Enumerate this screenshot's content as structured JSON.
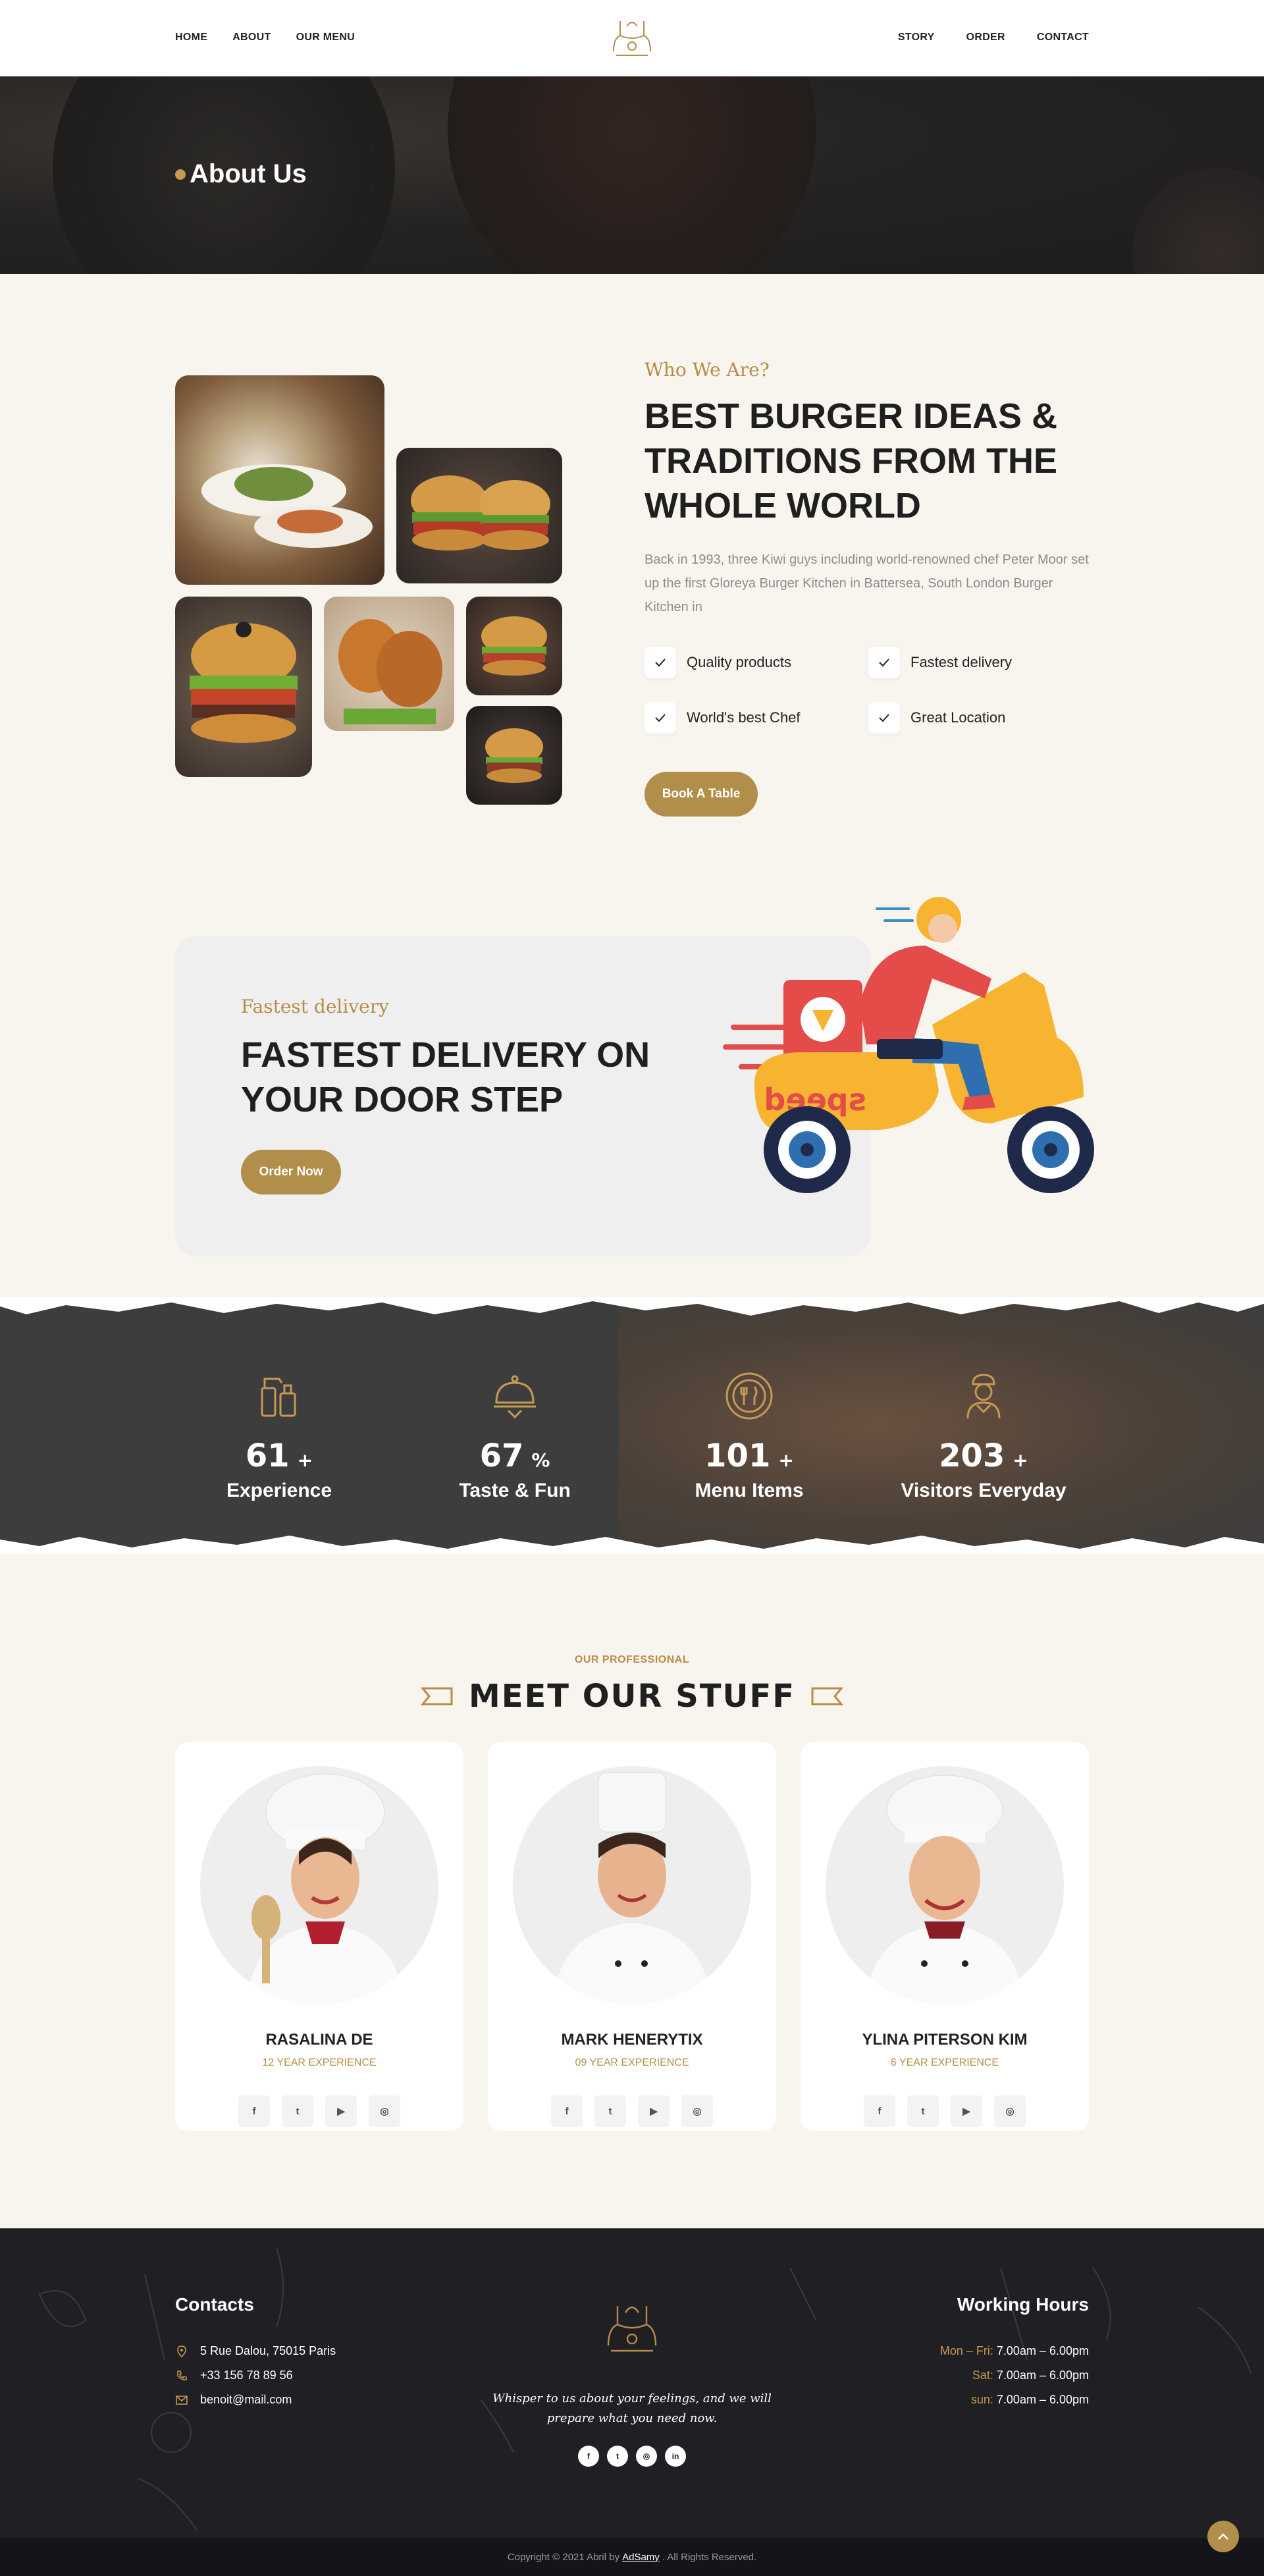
{
  "nav": {
    "left": [
      "HOME",
      "ABOUT",
      "OUR MENU"
    ],
    "right": [
      "STORY",
      "ORDER",
      "CONTACT"
    ]
  },
  "banner": {
    "title": "About Us"
  },
  "about": {
    "subtitle": "Who We Are?",
    "title": "BEST BURGER IDEAS & TRADITIONS FROM THE WHOLE WORLD",
    "text": "Back in 1993, three Kiwi guys including world-renowned chef Peter Moor set up the first Gloreya Burger Kitchen in Battersea, South London Burger Kitchen in",
    "features": [
      "Quality products",
      "Fastest delivery",
      "World's best Chef",
      "Great Location"
    ],
    "button": "Book A Table"
  },
  "delivery": {
    "subtitle": "Fastest delivery",
    "title": "FASTEST DELIVERY ON YOUR DOOR STEP",
    "button": "Order Now",
    "scooter_text": "speed"
  },
  "stats": [
    {
      "number": "61",
      "suffix": "+",
      "label": "Experience",
      "icon": "chef-tools-icon"
    },
    {
      "number": "67",
      "suffix": "%",
      "label": "Taste & Fun",
      "icon": "cloche-icon"
    },
    {
      "number": "101",
      "suffix": "+",
      "label": "Menu Items",
      "icon": "plate-cutlery-icon"
    },
    {
      "number": "203",
      "suffix": "+",
      "label": "Visitors Everyday",
      "icon": "chef-person-icon"
    }
  ],
  "team": {
    "subtitle": "OUR PROFESSIONAL",
    "title": "MEET OUR STUFF",
    "members": [
      {
        "name": "RASALINA DE",
        "experience": "12 YEAR EXPERIENCE"
      },
      {
        "name": "MARK HENERYTIX",
        "experience": "09 YEAR EXPERIENCE"
      },
      {
        "name": "YLINA PITERSON KIM",
        "experience": "6 YEAR EXPERIENCE"
      }
    ],
    "social_labels": [
      "f",
      "t",
      "▶",
      "◎"
    ]
  },
  "footer": {
    "contacts_title": "Contacts",
    "address": "5 Rue Dalou, 75015 Paris",
    "phone": "+33 156 78 89 56",
    "email": "benoit@mail.com",
    "quote": "Whisper to us about your feelings, and we will prepare what you need now.",
    "social_labels": [
      "f",
      "t",
      "◎",
      "in"
    ],
    "hours_title": "Working Hours",
    "hours": [
      {
        "day": "Mon – Fri:",
        "time": "7.00am – 6.00pm"
      },
      {
        "day": "Sat:",
        "time": "7.00am – 6.00pm"
      },
      {
        "day": "sun:",
        "time": "7.00am – 6.00pm"
      }
    ],
    "copyright_pre": "Copyright © 2021 Abril by",
    "copyright_link": "AdSamy",
    "copyright_post": ". All Rights Reserved."
  },
  "colors": {
    "accent": "#b18f4b",
    "dark": "#1f1f24",
    "background": "#f8f5ef"
  }
}
